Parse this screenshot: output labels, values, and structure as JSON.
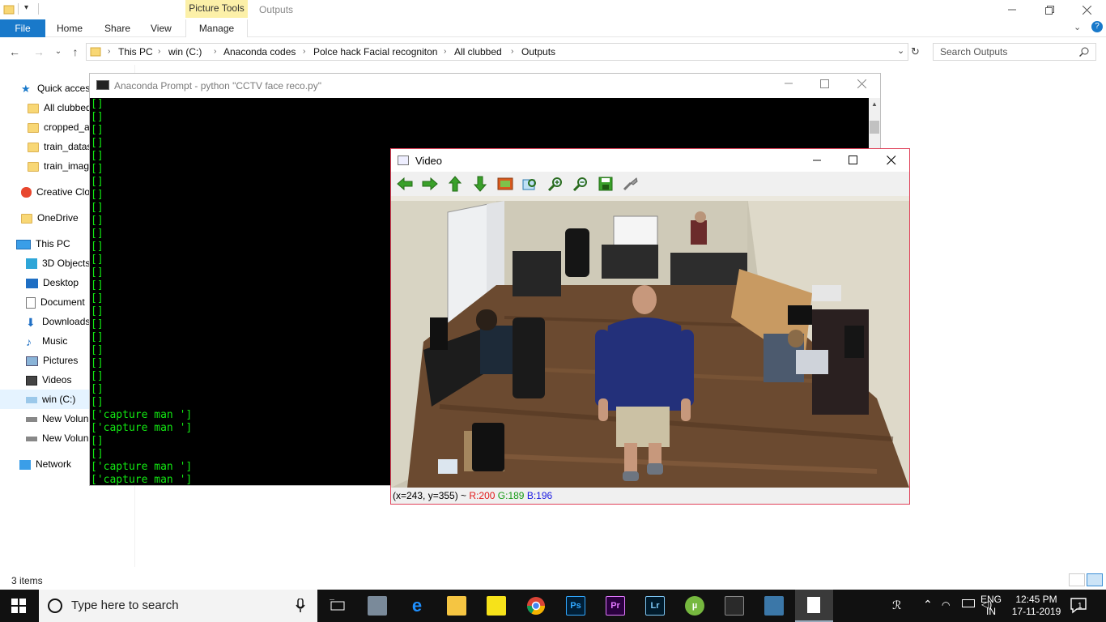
{
  "explorer": {
    "context_tab": "Picture Tools",
    "window_title": "Outputs",
    "ribbon_tabs": [
      "File",
      "Home",
      "Share",
      "View",
      "Manage"
    ],
    "breadcrumbs": [
      "This PC",
      "win  (C:)",
      "Anaconda codes",
      "Polce hack Facial recogniton",
      "All clubbed",
      "Outputs"
    ],
    "search_placeholder": "Search Outputs",
    "nav_items": [
      {
        "label": "Quick access",
        "icon": "star-icon"
      },
      {
        "label": "All clubbed",
        "icon": "folder-icon"
      },
      {
        "label": "cropped_a",
        "icon": "folder-icon"
      },
      {
        "label": "train_datas",
        "icon": "folder-icon"
      },
      {
        "label": "train_imag",
        "icon": "folder-icon"
      },
      {
        "label": "Creative Clo",
        "icon": "creative-cloud-icon"
      },
      {
        "label": "OneDrive",
        "icon": "folder-icon"
      },
      {
        "label": "This PC",
        "icon": "computer-icon"
      },
      {
        "label": "3D Objects",
        "icon": "cube-icon"
      },
      {
        "label": "Desktop",
        "icon": "desktop-icon"
      },
      {
        "label": "Document",
        "icon": "document-icon"
      },
      {
        "label": "Downloads",
        "icon": "download-icon"
      },
      {
        "label": "Music",
        "icon": "music-icon"
      },
      {
        "label": "Pictures",
        "icon": "pictures-icon"
      },
      {
        "label": "Videos",
        "icon": "videos-icon"
      },
      {
        "label": "win  (C:)",
        "icon": "drive-icon"
      },
      {
        "label": "New Volun",
        "icon": "drive-icon"
      },
      {
        "label": "New Volun",
        "icon": "drive-icon"
      },
      {
        "label": "Network",
        "icon": "network-icon"
      }
    ],
    "status_text": "3 items"
  },
  "conda": {
    "title": "Anaconda Prompt - python  \"CCTV face reco.py\"",
    "lines": [
      "[]",
      "[]",
      "[]",
      "[]",
      "[]",
      "[]",
      "[]",
      "[]",
      "[]",
      "[]",
      "[]",
      "[]",
      "[]",
      "[]",
      "[]",
      "[]",
      "[]",
      "[]",
      "[]",
      "[]",
      "[]",
      "[]",
      "[]",
      "[]",
      "['capture man ']",
      "['capture man ']",
      "[]",
      "[]",
      "['capture man ']",
      "['capture man ']"
    ]
  },
  "video": {
    "title": "Video",
    "tools": [
      "arrow-left-icon",
      "arrow-right-icon",
      "arrow-up-icon",
      "arrow-down-icon",
      "image-icon",
      "zoom-fit-icon",
      "zoom-in-icon",
      "zoom-out-icon",
      "save-icon",
      "properties-icon"
    ],
    "coords": "(x=243, y=355) ~ ",
    "r": "R:200",
    "g": "G:189",
    "b": "B:196"
  },
  "taskbar": {
    "search_placeholder": "Type here to search",
    "lang_top": "ENG",
    "lang_bottom": "IN",
    "time": "12:45 PM",
    "date": "17-11-2019",
    "notification_count": "1"
  },
  "colors": {
    "accent": "#1979ca",
    "terminal_text": "#12e712",
    "video_border": "#e0425a"
  }
}
